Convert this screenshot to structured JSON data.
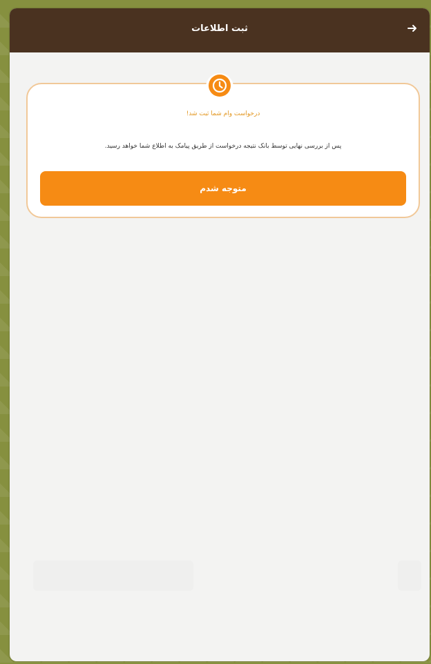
{
  "header": {
    "title": "ثبت اطلاعات",
    "back_icon": "arrow-right-icon"
  },
  "status": {
    "icon": "clock-icon",
    "title": "درخواست وام شما ثبت شد!",
    "message": "پس از بررسی نهایی توسط بانک نتیجه درخواست از طریق پیامک به اطلاع شما خواهد رسید.",
    "button_label": "متوجه شدم"
  },
  "colors": {
    "header_bg": "#4a3220",
    "accent": "#f68b14",
    "accent_text": "#e2961f",
    "card_border": "#f1c898",
    "page_bg": "#f3f3f2"
  }
}
